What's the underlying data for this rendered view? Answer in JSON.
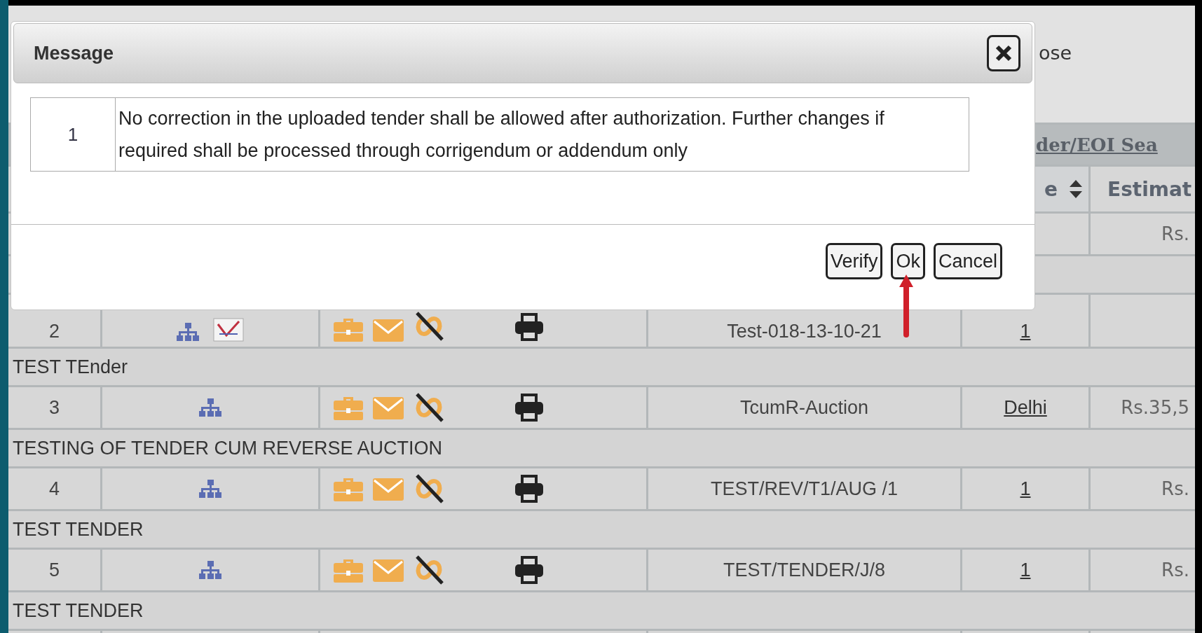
{
  "page": {
    "close_text": "ose",
    "section_heading": "der/EOI Sea",
    "columns": [
      {
        "label": "e",
        "sortable": true
      },
      {
        "label": "Estimat"
      }
    ],
    "rows": [
      {
        "estimate": "Rs."
      },
      {
        "number": "2",
        "actions": true,
        "certificate": true,
        "reference": "Test-018-13-10-21",
        "location": "1",
        "description": "TEST TEnder"
      },
      {
        "number": "3",
        "actions": true,
        "certificate": false,
        "reference": "TcumR-Auction",
        "location": "Delhi",
        "estimate": "Rs.35,5",
        "description": "TESTING OF TENDER CUM REVERSE AUCTION"
      },
      {
        "number": "4",
        "actions": true,
        "certificate": false,
        "reference": "TEST/REV/T1/AUG /1",
        "location": "1",
        "estimate": "Rs.",
        "description": "TEST TENDER"
      },
      {
        "number": "5",
        "actions": true,
        "certificate": false,
        "reference": "TEST/TENDER/J/8",
        "location": "1",
        "estimate": "Rs.",
        "description": "TEST TENDER"
      }
    ]
  },
  "dialog": {
    "title": "Message",
    "messages": [
      {
        "number": "1",
        "text": "No correction in the uploaded tender shall be allowed after authorization. Further changes if required shall be processed through corrigendum or addendum only"
      }
    ],
    "buttons": [
      "Verify",
      "Ok",
      "Cancel"
    ]
  }
}
